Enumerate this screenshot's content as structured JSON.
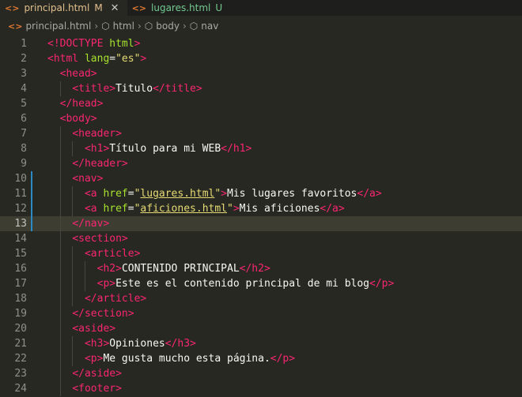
{
  "tabs": [
    {
      "name": "principal.html",
      "badge": "M",
      "active": true
    },
    {
      "name": "lugares.html",
      "badge": "U",
      "active": false
    }
  ],
  "breadcrumb": [
    "principal.html",
    "html",
    "body",
    "nav"
  ],
  "icons": {
    "file": "html-file-icon",
    "element": "cube-icon",
    "close": "close-icon"
  },
  "active_line": 13,
  "lines": [
    [
      [
        "t",
        "<!DOCTYPE "
      ],
      [
        "a",
        "html"
      ],
      [
        "t",
        ">"
      ]
    ],
    [
      [
        "t",
        "<html "
      ],
      [
        "a",
        "lang"
      ],
      [
        "w",
        "="
      ],
      [
        "s",
        "\"es\""
      ],
      [
        "t",
        ">"
      ]
    ],
    [
      [
        "i",
        "  "
      ],
      [
        "t",
        "<head>"
      ]
    ],
    [
      [
        "i",
        "    "
      ],
      [
        "t",
        "<title>"
      ],
      [
        "w",
        "Titulo"
      ],
      [
        "t",
        "</title>"
      ]
    ],
    [
      [
        "i",
        "  "
      ],
      [
        "t",
        "</head>"
      ]
    ],
    [
      [
        "i",
        "  "
      ],
      [
        "t",
        "<body>"
      ]
    ],
    [
      [
        "i",
        "    "
      ],
      [
        "t",
        "<header>"
      ]
    ],
    [
      [
        "i",
        "      "
      ],
      [
        "t",
        "<h1>"
      ],
      [
        "w",
        "Título para mi WEB"
      ],
      [
        "t",
        "</h1>"
      ]
    ],
    [
      [
        "i",
        "    "
      ],
      [
        "t",
        "</header>"
      ]
    ],
    [
      [
        "i",
        "    "
      ],
      [
        "t",
        "<nav>"
      ]
    ],
    [
      [
        "i",
        "      "
      ],
      [
        "t",
        "<a "
      ],
      [
        "a",
        "href"
      ],
      [
        "w",
        "="
      ],
      [
        "s",
        "\""
      ],
      [
        "u",
        "lugares.html"
      ],
      [
        "s",
        "\""
      ],
      [
        "t",
        ">"
      ],
      [
        "w",
        "Mis lugares favoritos"
      ],
      [
        "t",
        "</a>"
      ]
    ],
    [
      [
        "i",
        "      "
      ],
      [
        "t",
        "<a "
      ],
      [
        "a",
        "href"
      ],
      [
        "w",
        "="
      ],
      [
        "s",
        "\""
      ],
      [
        "u",
        "aficiones.html"
      ],
      [
        "s",
        "\""
      ],
      [
        "t",
        ">"
      ],
      [
        "w",
        "Mis aficiones"
      ],
      [
        "t",
        "</a>"
      ]
    ],
    [
      [
        "i",
        "    "
      ],
      [
        "t",
        "</nav>"
      ]
    ],
    [
      [
        "i",
        "    "
      ],
      [
        "t",
        "<section>"
      ]
    ],
    [
      [
        "i",
        "      "
      ],
      [
        "t",
        "<article>"
      ]
    ],
    [
      [
        "i",
        "        "
      ],
      [
        "t",
        "<h2>"
      ],
      [
        "w",
        "CONTENIDO PRINCIPAL"
      ],
      [
        "t",
        "</h2>"
      ]
    ],
    [
      [
        "i",
        "        "
      ],
      [
        "t",
        "<p>"
      ],
      [
        "w",
        "Este es el contenido principal de mi blog"
      ],
      [
        "t",
        "</p>"
      ]
    ],
    [
      [
        "i",
        "      "
      ],
      [
        "t",
        "</article>"
      ]
    ],
    [
      [
        "i",
        "    "
      ],
      [
        "t",
        "</section>"
      ]
    ],
    [
      [
        "i",
        "    "
      ],
      [
        "t",
        "<aside>"
      ]
    ],
    [
      [
        "i",
        "      "
      ],
      [
        "t",
        "<h3>"
      ],
      [
        "w",
        "Opiniones"
      ],
      [
        "t",
        "</h3>"
      ]
    ],
    [
      [
        "i",
        "      "
      ],
      [
        "t",
        "<p>"
      ],
      [
        "w",
        "Me gusta mucho esta página."
      ],
      [
        "t",
        "</p>"
      ]
    ],
    [
      [
        "i",
        "    "
      ],
      [
        "t",
        "</aside>"
      ]
    ],
    [
      [
        "i",
        "    "
      ],
      [
        "t",
        "<footer>"
      ]
    ]
  ]
}
